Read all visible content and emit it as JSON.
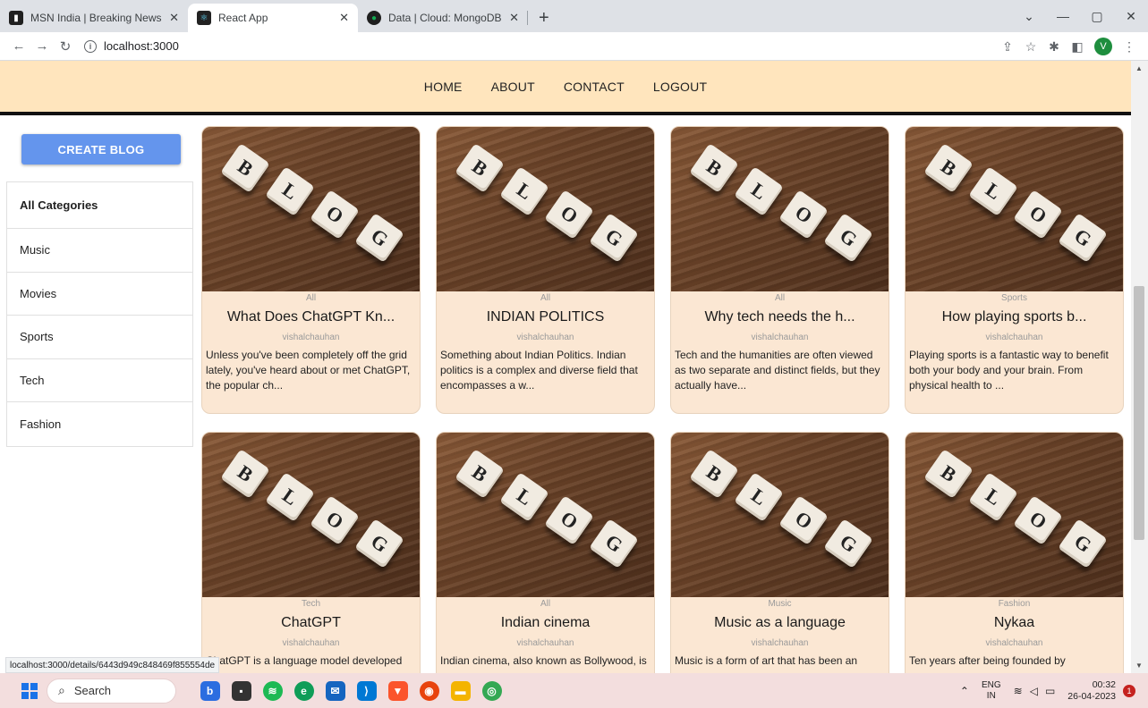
{
  "browser": {
    "tabs": [
      {
        "title": "MSN India | Breaking News, Ente",
        "favicon": "msn-icon",
        "active": false
      },
      {
        "title": "React App",
        "favicon": "react-icon",
        "active": true
      },
      {
        "title": "Data | Cloud: MongoDB Cloud",
        "favicon": "mongodb-icon",
        "active": false
      }
    ],
    "new_tab": "+",
    "url": "localhost:3000",
    "profile_initial": "V",
    "status_url": "localhost:3000/details/6443d949c848469f855554de"
  },
  "nav": {
    "links": [
      "HOME",
      "ABOUT",
      "CONTACT",
      "LOGOUT"
    ]
  },
  "sidebar": {
    "create_label": "CREATE BLOG",
    "categories": [
      "All Categories",
      "Music",
      "Movies",
      "Sports",
      "Tech",
      "Fashion"
    ]
  },
  "tile_letters": [
    "B",
    "L",
    "O",
    "G"
  ],
  "posts": [
    {
      "category": "All",
      "title": "What Does ChatGPT Kn...",
      "author": "vishalchauhan",
      "description": "Unless you've been completely off the grid lately, you've heard about or met ChatGPT, the popular ch..."
    },
    {
      "category": "All",
      "title": "INDIAN POLITICS",
      "author": "vishalchauhan",
      "description": "Something about Indian Politics. Indian politics is a complex and diverse field that encompasses a w..."
    },
    {
      "category": "All",
      "title": "Why tech needs the h...",
      "author": "vishalchauhan",
      "description": "Tech and the humanities are often viewed as two separate and distinct fields, but they actually have..."
    },
    {
      "category": "Sports",
      "title": "How playing sports b...",
      "author": "vishalchauhan",
      "description": "Playing sports is a fantastic way to benefit both your body and your brain. From physical health to ..."
    },
    {
      "category": "Tech",
      "title": "ChatGPT",
      "author": "vishalchauhan",
      "description": "ChatGPT is a language model developed by"
    },
    {
      "category": "All",
      "title": "Indian cinema",
      "author": "vishalchauhan",
      "description": "Indian cinema, also known as Bollywood, is"
    },
    {
      "category": "Music",
      "title": "Music as a language",
      "author": "vishalchauhan",
      "description": "Music is a form of art that has been an"
    },
    {
      "category": "Fashion",
      "title": "Nykaa",
      "author": "vishalchauhan",
      "description": "Ten years after being founded by"
    }
  ],
  "taskbar": {
    "search_label": "Search",
    "lang_top": "ENG",
    "lang_bottom": "IN",
    "time": "00:32",
    "date": "26-04-2023",
    "notifications": "1"
  },
  "colors": {
    "navbar_bg": "#ffe5bd",
    "card_bg": "#fbe7d3",
    "create_button": "#6495ed"
  }
}
